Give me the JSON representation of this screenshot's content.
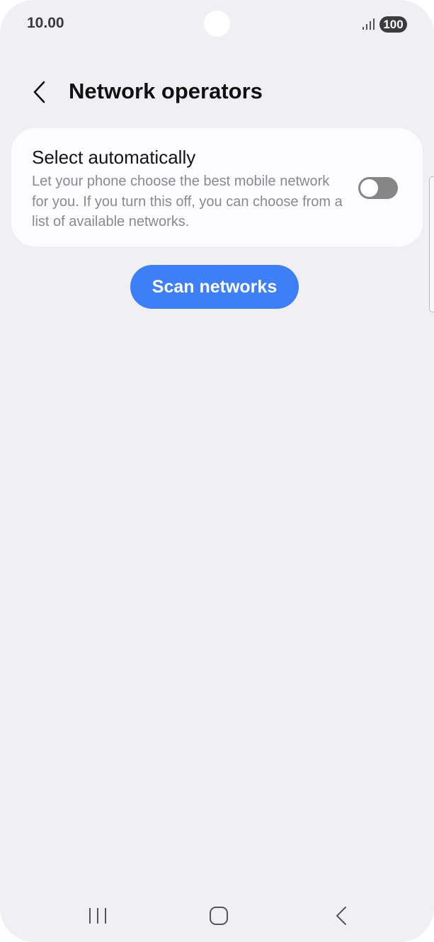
{
  "status_bar": {
    "time": "10.00",
    "battery": "100",
    "icons": [
      "camera-cutout",
      "signal-icon",
      "battery-icon"
    ]
  },
  "header": {
    "back_icon": "chevron-left-icon",
    "title": "Network operators"
  },
  "select_automatically": {
    "title": "Select automatically",
    "description": "Let your phone choose the best mobile network for you. If you turn this off, you can choose from a list of available networks.",
    "toggle_state": "off"
  },
  "scan_button": {
    "label": "Scan networks",
    "color": "#3d7ff7"
  },
  "nav_bar": {
    "icons": [
      "recent-apps-icon",
      "home-icon",
      "back-icon"
    ]
  },
  "colors": {
    "background": "#f0f0f2",
    "card": "#fcfcfe",
    "toggle_off": "#868686"
  }
}
